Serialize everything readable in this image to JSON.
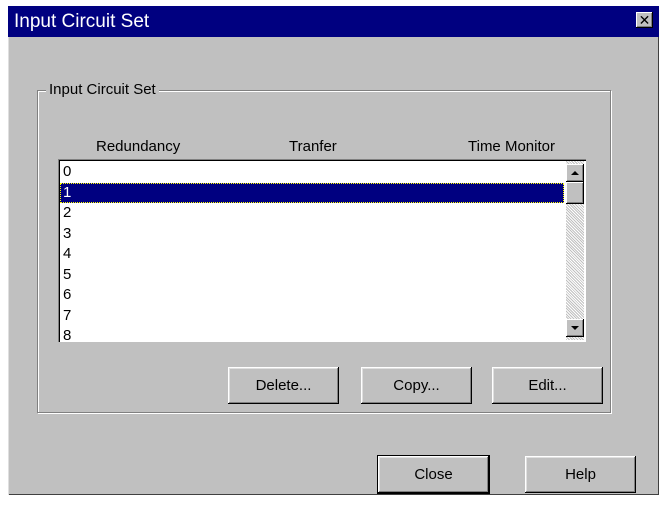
{
  "window": {
    "title": "Input Circuit Set",
    "close_glyph": "✕"
  },
  "groupbox": {
    "label": "Input Circuit Set",
    "columns": [
      "Redundancy",
      "Tranfer",
      "Time Monitor"
    ]
  },
  "list": {
    "items": [
      "0",
      "1",
      "2",
      "3",
      "4",
      "5",
      "6",
      "7",
      "8"
    ],
    "selected_index": 1
  },
  "buttons": {
    "delete": "Delete...",
    "copy": "Copy...",
    "edit": "Edit...",
    "close": "Close",
    "help": "Help"
  },
  "colors": {
    "titlebar": "#000080",
    "face": "#c0c0c0",
    "selection": "#000080"
  }
}
